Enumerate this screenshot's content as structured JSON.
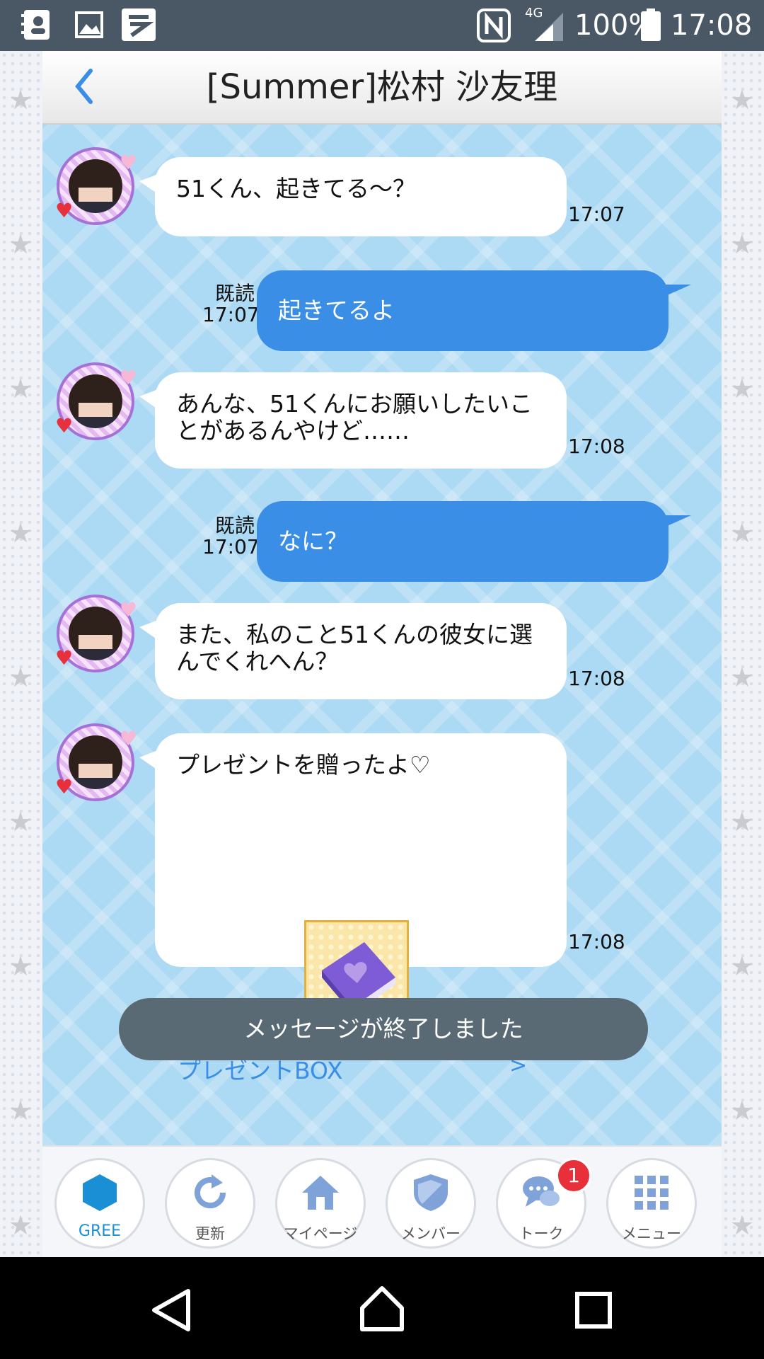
{
  "status_bar": {
    "network": "4G",
    "battery": "100%",
    "time": "17:08"
  },
  "header": {
    "title": "[Summer]松村 沙友理"
  },
  "messages": [
    {
      "text": "51くん、起きてる～？",
      "time": "17:07"
    },
    {
      "text": "起きてるよ",
      "read": "既読",
      "time": "17:07"
    },
    {
      "text": "あんな、51くんにお願いしたいことがあるんやけど……",
      "time": "17:08"
    },
    {
      "text": "なに？",
      "read": "既読",
      "time": "17:07"
    },
    {
      "text": "また、私のこと51くんの彼女に選んでくれへん？",
      "time": "17:08"
    },
    {
      "text": "プレゼントを贈ったよ♡",
      "time": "17:08",
      "link": "プレゼントBOX",
      "link_arrow": ">"
    }
  ],
  "end_notice": "メッセージが終了しました",
  "nav": {
    "items": [
      {
        "label": "GREE"
      },
      {
        "label": "更新"
      },
      {
        "label": "マイページ"
      },
      {
        "label": "メンバー"
      },
      {
        "label": "トーク",
        "badge": "1"
      },
      {
        "label": "メニュー"
      }
    ]
  },
  "colors": {
    "accent_blue": "#3a8ee6",
    "chat_bg": "#acd9f3",
    "status_bar": "#4a5866",
    "badge_red": "#e8303a"
  }
}
